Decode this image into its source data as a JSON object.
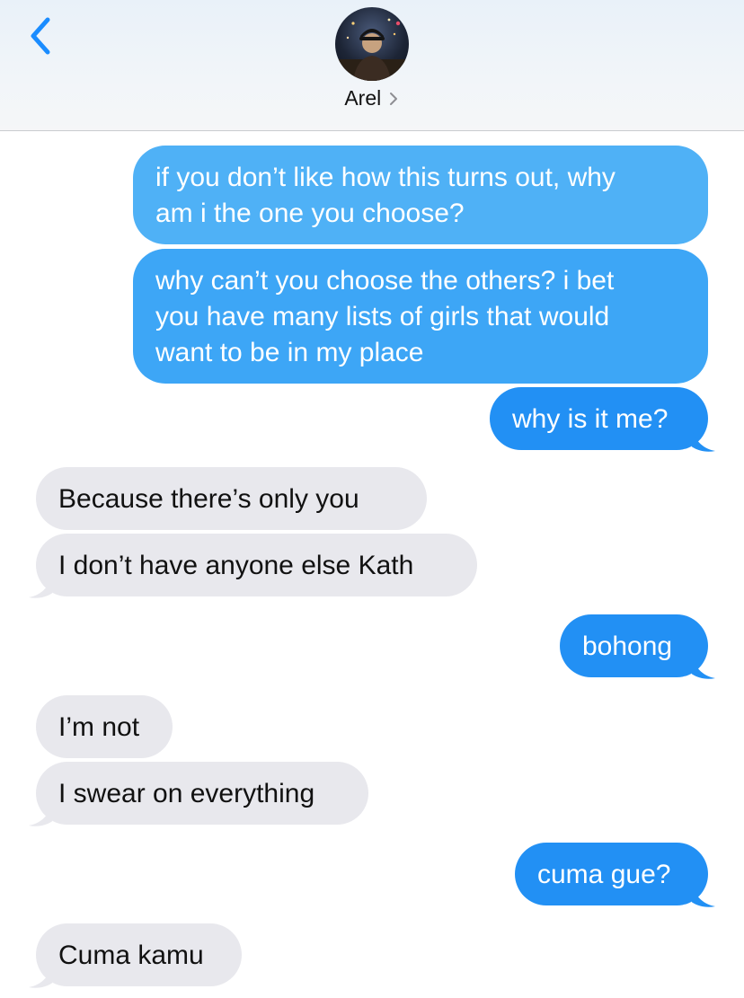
{
  "header": {
    "contact_name": "Arel",
    "back_icon": "chevron-left-icon",
    "avatar_icon": "contact-avatar",
    "detail_icon": "chevron-right-icon"
  },
  "colors": {
    "accent": "#1a8cff",
    "sent_bubble_top": "#4fb1f6",
    "sent_bubble_bottom": "#2290f4",
    "received_bubble": "#e8e8ed"
  },
  "messages": [
    {
      "from": "me",
      "lines": [
        "if you don’t like how this turns out, why",
        "am i the one you choose?"
      ]
    },
    {
      "from": "me",
      "lines": [
        "why can’t you choose the others? i bet",
        "you have many lists of girls that would",
        "want to be in my place"
      ]
    },
    {
      "from": "me",
      "lines": [
        "why is it me?"
      ]
    },
    {
      "from": "them",
      "lines": [
        "Because there’s only you"
      ]
    },
    {
      "from": "them",
      "lines": [
        "I don’t have anyone else Kath"
      ]
    },
    {
      "from": "me",
      "lines": [
        "bohong"
      ]
    },
    {
      "from": "them",
      "lines": [
        "I’m not"
      ]
    },
    {
      "from": "them",
      "lines": [
        "I swear on everything"
      ]
    },
    {
      "from": "me",
      "lines": [
        "cuma gue?"
      ]
    },
    {
      "from": "them",
      "lines": [
        "Cuma kamu"
      ]
    }
  ]
}
